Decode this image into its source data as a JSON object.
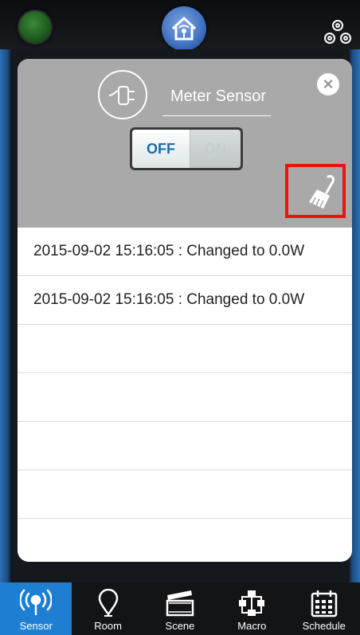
{
  "device": {
    "title": "Meter Sensor",
    "switch_off_label": "OFF",
    "switch_on_label": "ON",
    "state": "OFF"
  },
  "log": {
    "entries": [
      "2015-09-02 15:16:05 : Changed to 0.0W",
      "2015-09-02 15:16:05 : Changed to 0.0W",
      "",
      "",
      "",
      "",
      ""
    ]
  },
  "tabs": [
    {
      "label": "Sensor",
      "icon": "sensor-icon",
      "active": true
    },
    {
      "label": "Room",
      "icon": "room-icon",
      "active": false
    },
    {
      "label": "Scene",
      "icon": "scene-icon",
      "active": false
    },
    {
      "label": "Macro",
      "icon": "macro-icon",
      "active": false
    },
    {
      "label": "Schedule",
      "icon": "schedule-icon",
      "active": false
    }
  ],
  "colors": {
    "accent": "#1e7fd2",
    "highlight": "#ee1111",
    "header_bg": "#a9a9a9",
    "switch_text": "#1b6ab0"
  }
}
